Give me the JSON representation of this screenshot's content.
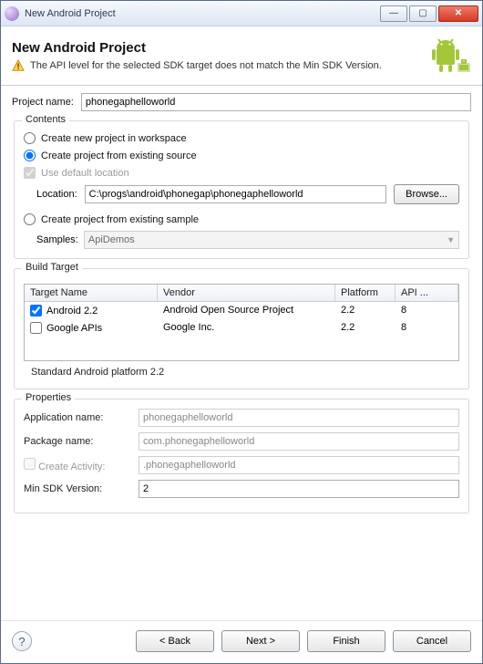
{
  "window": {
    "title": "New Android Project"
  },
  "header": {
    "heading": "New Android Project",
    "warning": "The API level for the selected SDK target does not match the Min SDK Version."
  },
  "project": {
    "label": "Project name:",
    "value": "phonegaphelloworld"
  },
  "contents": {
    "legend": "Contents",
    "opt_workspace": "Create new project in workspace",
    "opt_existing": "Create project from existing source",
    "use_default": "Use default location",
    "location_label": "Location:",
    "location_value": "C:\\progs\\android\\phonegap\\phonegaphelloworld",
    "browse": "Browse...",
    "opt_sample": "Create project from existing sample",
    "samples_label": "Samples:",
    "samples_value": "ApiDemos"
  },
  "build": {
    "legend": "Build Target",
    "headers": {
      "name": "Target Name",
      "vendor": "Vendor",
      "platform": "Platform",
      "api": "API ..."
    },
    "rows": [
      {
        "checked": true,
        "name": "Android 2.2",
        "vendor": "Android Open Source Project",
        "platform": "2.2",
        "api": "8"
      },
      {
        "checked": false,
        "name": "Google APIs",
        "vendor": "Google Inc.",
        "platform": "2.2",
        "api": "8"
      }
    ],
    "footer": "Standard Android platform 2.2"
  },
  "props": {
    "legend": "Properties",
    "appname_label": "Application name:",
    "appname_value": "phonegaphelloworld",
    "pkg_label": "Package name:",
    "pkg_value": "com.phonegaphelloworld",
    "create_activity_label": "Create Activity:",
    "create_activity_value": ".phonegaphelloworld",
    "minsdk_label": "Min SDK Version:",
    "minsdk_value": "2"
  },
  "buttons": {
    "back": "< Back",
    "next": "Next >",
    "finish": "Finish",
    "cancel": "Cancel"
  }
}
